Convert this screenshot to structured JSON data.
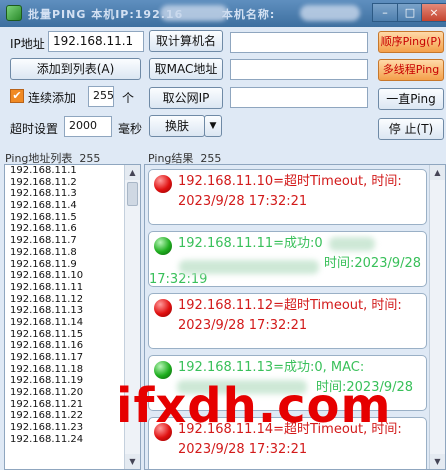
{
  "window": {
    "title_prefix": "批量PING 本机IP:192.16",
    "title_mid": "本机名称:",
    "buttons": {
      "minimize": "–",
      "maximize": "□",
      "close": "×"
    }
  },
  "form": {
    "ip_label": "IP地址",
    "ip_value": "192.168.11.1",
    "btn_get_hostname": "取计算机名",
    "btn_add_list": "添加到列表(A)",
    "btn_get_mac": "取MAC地址",
    "continuous_label": "连续添加",
    "continuous_count": "255",
    "count_unit": "个",
    "btn_public_ip": "取公网IP",
    "timeout_label": "超时设置",
    "timeout_value": "2000",
    "timeout_unit": "毫秒",
    "btn_skin": "换肤",
    "btn_seq_ping": "顺序Ping(P)",
    "btn_multi_ping": "多线程Ping",
    "btn_loop_ping": "一直Ping",
    "btn_stop": "停 止(T)"
  },
  "ip_list": {
    "header": "Ping地址列表",
    "count": "255",
    "items": [
      "192.168.11.1",
      "192.168.11.2",
      "192.168.11.3",
      "192.168.11.4",
      "192.168.11.5",
      "192.168.11.6",
      "192.168.11.7",
      "192.168.11.8",
      "192.168.11.9",
      "192.168.11.10",
      "192.168.11.11",
      "192.168.11.12",
      "192.168.11.13",
      "192.168.11.14",
      "192.168.11.15",
      "192.168.11.16",
      "192.168.11.17",
      "192.168.11.18",
      "192.168.11.19",
      "192.168.11.20",
      "192.168.11.21",
      "192.168.11.22",
      "192.168.11.23",
      "192.168.11.24"
    ]
  },
  "results": {
    "header": "Ping结果",
    "count": "255",
    "cards": [
      {
        "status": "red",
        "line1": "192.168.11.10=超时Timeout, 时间:",
        "line2": "2023/9/28 17:32:21"
      },
      {
        "status": "green",
        "line1": "192.168.11.11=成功:0",
        "line2": "时间:2023/9/28",
        "line3": "17:32:19"
      },
      {
        "status": "red",
        "line1": "192.168.11.12=超时Timeout, 时间:",
        "line2": "2023/9/28 17:32:21"
      },
      {
        "status": "green",
        "line1": "192.168.11.13=成功:0, MAC:",
        "line2": "时间:2023/9/28"
      },
      {
        "status": "red",
        "line1": "192.168.11.14=超时Timeout, 时间:",
        "line2": "2023/9/28 17:32:21"
      }
    ]
  },
  "watermark": "ifxdh.com"
}
